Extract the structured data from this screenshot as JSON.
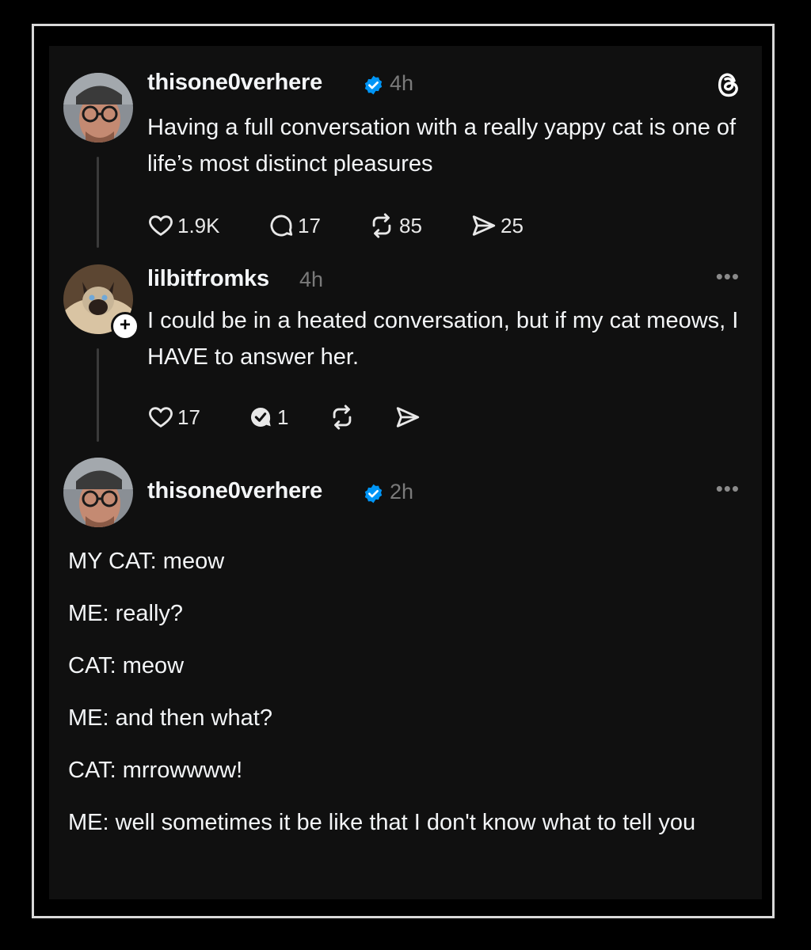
{
  "posts": [
    {
      "username": "thisone0verhere",
      "time": "4h",
      "text": "Having a full conversation with a really yappy cat is one of life’s most distinct pleasures",
      "likes": "1.9K",
      "replies": "17",
      "reposts": "85",
      "shares": "25",
      "verified": true,
      "header_icon": "threads-logo-icon"
    },
    {
      "username": "lilbitfromks",
      "time": "4h",
      "text": "I could be in a heated conversation, but if my cat meows, I HAVE to answer her.",
      "likes": "17",
      "replies": "1",
      "more": "•••"
    },
    {
      "username": "thisone0verhere",
      "time": "2h",
      "verified": true,
      "more": "•••",
      "dialogue": [
        "MY CAT: meow",
        "ME: really?",
        "CAT: meow",
        "ME: and then what?",
        "CAT: mrrowwww!",
        "ME: well sometimes it be like that I don't know what to tell you"
      ]
    }
  ],
  "colors": {
    "background": "#000000",
    "panel": "#101010",
    "text": "#f3f5f7",
    "muted": "#7a7a7a",
    "verified_blue": "#0095f6",
    "frame_border": "#d9d9d9"
  }
}
